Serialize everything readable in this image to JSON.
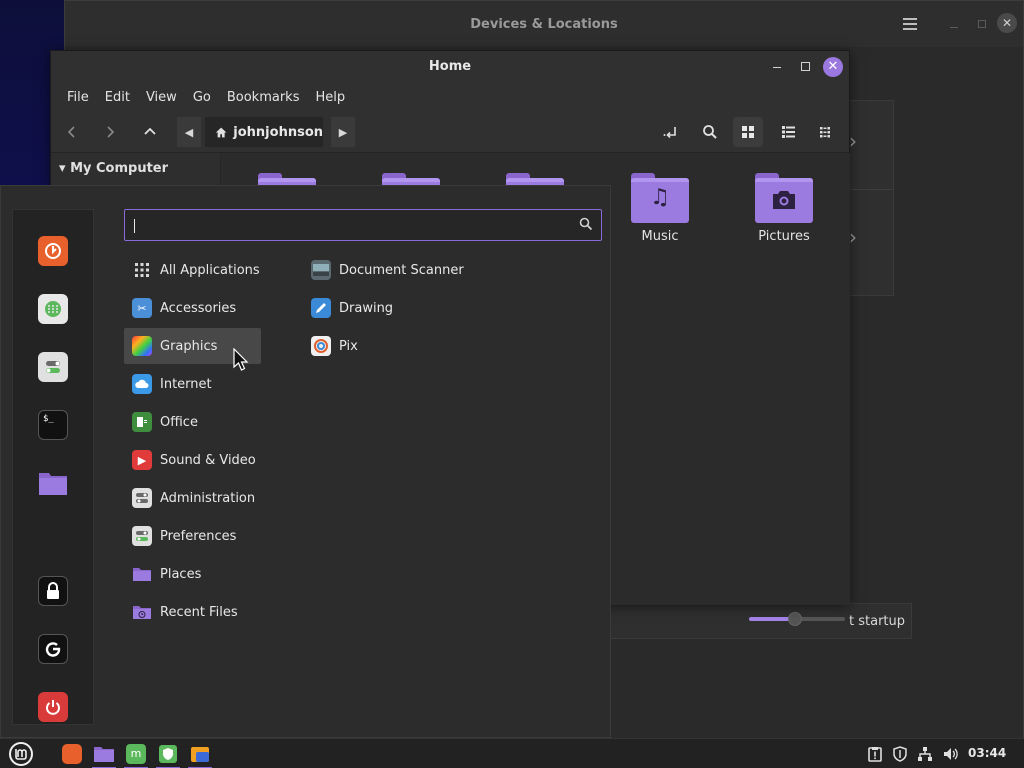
{
  "devices_window": {
    "title": "Devices & Locations",
    "startup_label": "t startup"
  },
  "home_window": {
    "title": "Home",
    "menubar": [
      "File",
      "Edit",
      "View",
      "Go",
      "Bookmarks",
      "Help"
    ],
    "path": "johnjohnson",
    "sidebar_header": "My Computer",
    "files": [
      {
        "name": "",
        "icon": "folder-icon"
      },
      {
        "name": "",
        "icon": "folder-icon"
      },
      {
        "name": "",
        "icon": "folder-icon"
      },
      {
        "name": "Music",
        "icon": "music-folder-icon"
      },
      {
        "name": "Pictures",
        "icon": "pictures-folder-icon"
      }
    ]
  },
  "menu": {
    "search": {
      "value": "",
      "placeholder": ""
    },
    "categories": [
      {
        "label": "All Applications",
        "icon": "grid-icon"
      },
      {
        "label": "Accessories",
        "icon": "scissors-icon"
      },
      {
        "label": "Graphics",
        "icon": "graphics-icon",
        "hover": true
      },
      {
        "label": "Internet",
        "icon": "cloud-icon"
      },
      {
        "label": "Office",
        "icon": "office-icon"
      },
      {
        "label": "Sound & Video",
        "icon": "play-icon"
      },
      {
        "label": "Administration",
        "icon": "admin-icon"
      },
      {
        "label": "Preferences",
        "icon": "preferences-icon"
      },
      {
        "label": "Places",
        "icon": "folder-icon"
      },
      {
        "label": "Recent Files",
        "icon": "recent-files-icon"
      }
    ],
    "apps": [
      {
        "label": "Document Scanner",
        "icon": "scanner-icon"
      },
      {
        "label": "Drawing",
        "icon": "drawing-icon"
      },
      {
        "label": "Pix",
        "icon": "pix-icon"
      }
    ],
    "favorites": [
      "firefox-icon",
      "software-manager-icon",
      "settings-icon",
      "terminal-icon",
      "files-icon"
    ],
    "session": [
      "lock-icon",
      "logout-icon",
      "power-icon"
    ]
  },
  "taskbar": {
    "clock": "03:44",
    "items": [
      "mint-menu-icon",
      "firefox-icon",
      "files-icon",
      "software-manager-icon",
      "shield-icon",
      "folder-window-icon"
    ],
    "tray": [
      "updates-icon",
      "shield-tray-icon",
      "network-icon",
      "volume-icon"
    ]
  },
  "colors": {
    "accent": "#9b78e0",
    "folder": "#9b7be0",
    "menu_bg": "#2c2c2c",
    "hover_bg": "#484848"
  }
}
